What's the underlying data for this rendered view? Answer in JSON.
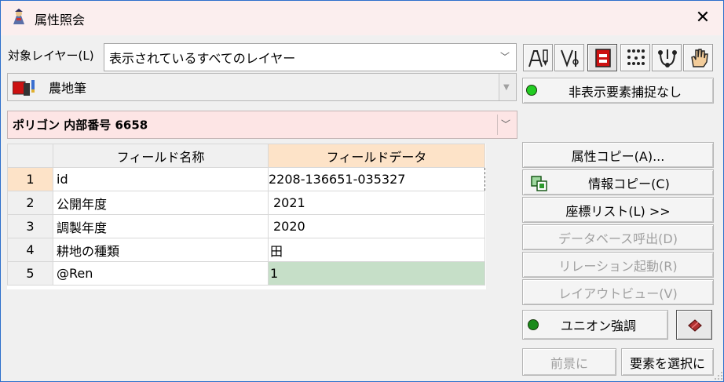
{
  "window": {
    "title": "属性照会",
    "close_glyph": "✕"
  },
  "target_layer": {
    "label": "対象レイヤー(L)",
    "value": "表示されているすべてのレイヤー"
  },
  "layer_select": {
    "value": "農地筆"
  },
  "feature_select": {
    "value": "ポリゴン 内部番号 6658"
  },
  "toolbar": {
    "icons": [
      "attribute-pen-icon",
      "measure-tools-icon",
      "red-layer-icon",
      "dotted-select-icon",
      "node-link-icon",
      "hand-icon"
    ],
    "active_index": 2
  },
  "hidden_snap": {
    "label": "非表示要素捕捉なし",
    "led_color": "#22cc22"
  },
  "table": {
    "headers": [
      "フィールド名称",
      "フィールドデータ"
    ],
    "rows": [
      {
        "num": "1",
        "field": "id",
        "data": "2208-136651-035327"
      },
      {
        "num": "2",
        "field": "公開年度",
        "data": "2021"
      },
      {
        "num": "3",
        "field": "調製年度",
        "data": "2020"
      },
      {
        "num": "4",
        "field": "耕地の種類",
        "data": "田"
      },
      {
        "num": "5",
        "field": "@Ren",
        "data": "1"
      }
    ]
  },
  "buttons": {
    "attr_copy": "属性コピー(A)...",
    "info_copy": "情報コピー(C)",
    "coord_list": "座標リスト(L) >>",
    "db_call": "データベース呼出(D)",
    "relation": "リレーション起動(R)",
    "layout_view": "レイアウトビュー(V)",
    "union_emphasis": "ユニオン強調",
    "foreground": "前景に",
    "select_element": "要素を選択に"
  },
  "colors": {
    "accent_border": "#2b6ecb",
    "titlebar_bg": "#fbeeee",
    "feature_bg": "#fde5e5",
    "header_selected": "#fde3c8",
    "data_highlight": "#c6dfc8",
    "union_led": "#1a8a1a"
  }
}
